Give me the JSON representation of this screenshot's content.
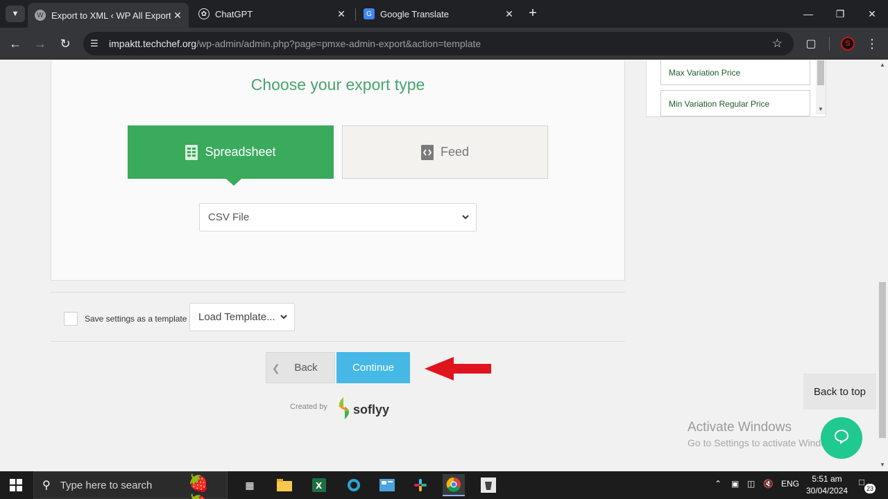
{
  "browser": {
    "tabs": [
      {
        "title": "Export to XML ‹ WP All Export ‹",
        "active": true
      },
      {
        "title": "ChatGPT",
        "active": false
      },
      {
        "title": "Google Translate",
        "active": false
      }
    ],
    "url_host": "impaktt.techchef.org",
    "url_path": "/wp-admin/admin.php?page=pmxe-admin-export&action=template",
    "profile_letter": "S"
  },
  "export": {
    "title": "Choose your export type",
    "spreadsheet_label": "Spreadsheet",
    "feed_label": "Feed",
    "file_type": "CSV File"
  },
  "template": {
    "save_label": "Save settings as a template",
    "load_label": "Load Template..."
  },
  "actions": {
    "back_label": "Back",
    "continue_label": "Continue"
  },
  "credits": {
    "created_by": "Created by",
    "brand": "soflyy"
  },
  "sidebar": {
    "items": [
      "Max Variation Price",
      "Min Variation Regular Price"
    ]
  },
  "back_to_top": "Back to top",
  "watermark": {
    "line1": "Activate Windows",
    "line2": "Go to Settings to activate Windows."
  },
  "taskbar": {
    "search_placeholder": "Type here to search",
    "language": "ENG",
    "time": "5:51 am",
    "date": "30/04/2024",
    "notifications": "23"
  },
  "colors": {
    "accent_green": "#3aaa5c",
    "continue_blue": "#46b8e6",
    "arrow_red": "#e0141e",
    "help_green": "#1fc98f"
  }
}
